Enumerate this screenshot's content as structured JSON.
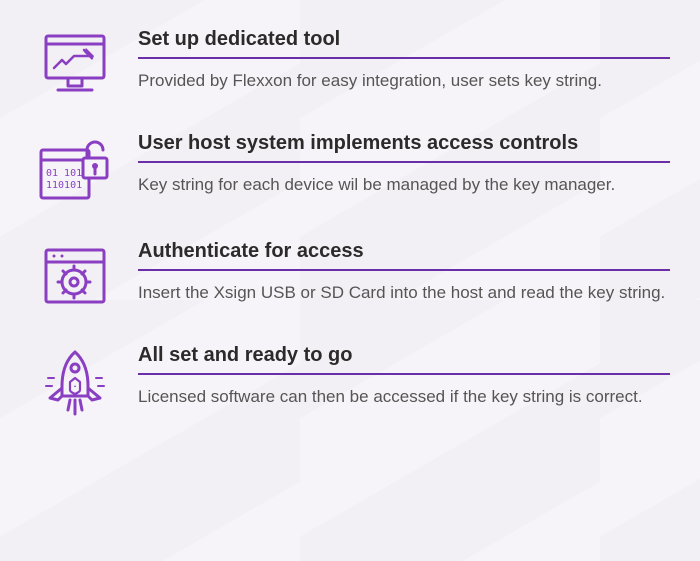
{
  "accent_color": "#8a3fc2",
  "steps": [
    {
      "icon": "setup-tool-icon",
      "title": "Set up dedicated tool",
      "desc": "Provided by Flexxon for easy integration, user sets key string."
    },
    {
      "icon": "access-controls-icon",
      "title": "User host system implements access controls",
      "desc": "Key string for each device wil be managed by the key manager."
    },
    {
      "icon": "authenticate-icon",
      "title": "Authenticate for access",
      "desc": "Insert the Xsign USB or SD Card into the host and read the key string."
    },
    {
      "icon": "ready-icon",
      "title": "All set and ready to go",
      "desc": "Licensed software can then be accessed if the key string is correct."
    }
  ]
}
